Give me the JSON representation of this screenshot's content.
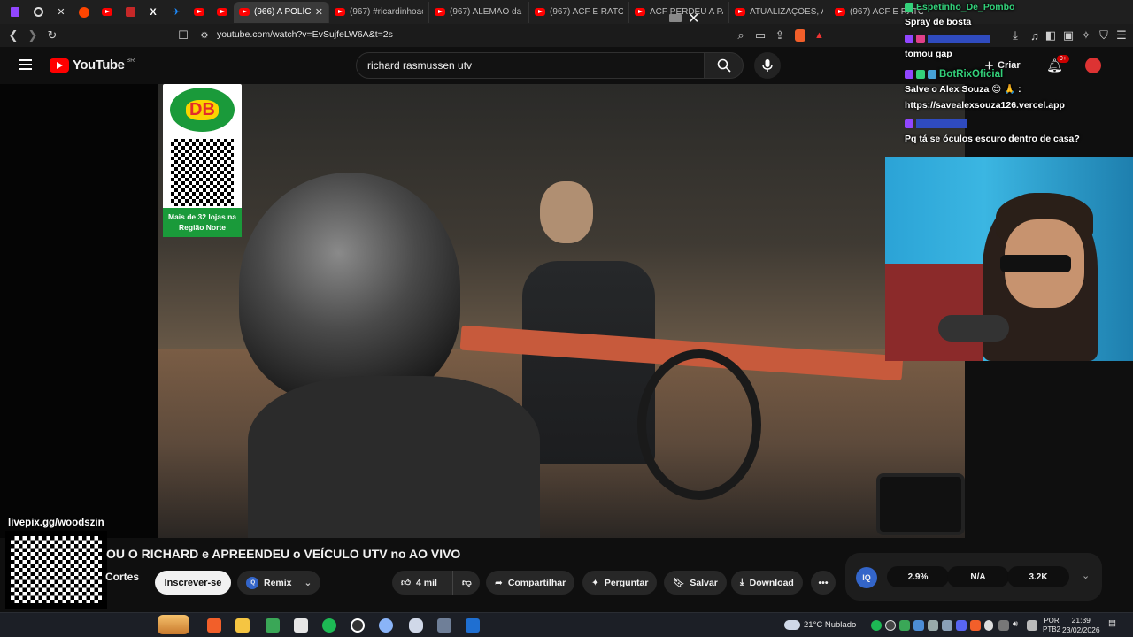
{
  "tabs": [
    {
      "label": "(966) A POLÍCIA P",
      "active": true
    },
    {
      "label": "(967) #ricardinhoacf #",
      "active": false
    },
    {
      "label": "(967) ALEMÃO da CAR",
      "active": false
    },
    {
      "label": "(967) ACF E RATO DIS",
      "active": false
    },
    {
      "label": "ACF PERDEU A PACIÊN",
      "active": false
    },
    {
      "label": "ATUALIZAÇÕES, ACF E",
      "active": false
    },
    {
      "label": "(967) ACF E RATO DIS",
      "active": false
    }
  ],
  "address": {
    "url": "youtube.com/watch?v=EvSujfeLW6A&t=2s"
  },
  "youtube": {
    "logo": "YouTube",
    "region": "BR",
    "search_query": "richard rasmussen utv",
    "create_label": "Criar",
    "notif_count": "9+"
  },
  "ad": {
    "brand": "DB",
    "text": "Mais de 32 lojas na Região Norte"
  },
  "chat": [
    {
      "user": "Espetinho_De_Pombo",
      "user_color": "#33d17a",
      "message": "Spray de bosta"
    },
    {
      "user": "",
      "user_color": "#5a7bff",
      "message": "tomou gap"
    },
    {
      "user": "BotRixOficial",
      "user_color": "#33d17a",
      "message": "Salve o Alex Souza 😊 🙏 :"
    },
    {
      "user": "",
      "user_color": "#ffffff",
      "message": "https://savealexsouza126.vercel.app"
    },
    {
      "user": "",
      "user_color": "#5a7bff",
      "message": "Pq tá se óculos escuro dentro de casa?"
    }
  ],
  "overlay": {
    "livepix": "livepix.gg/woodszin"
  },
  "video": {
    "title": "OU O RICHARD e APREENDEU o VEÍCULO UTV no AO VIVO",
    "channel": "Cortes",
    "subscribe_label": "Inscrever-se",
    "remix_label": "Remix",
    "likes": "4 mil",
    "share_label": "Compartilhar",
    "ask_label": "Perguntar",
    "save_label": "Salvar",
    "download_label": "Download"
  },
  "iq_stats": [
    "2.9%",
    "N/A",
    "3.2K"
  ],
  "taskbar": {
    "weather": "21°C  Nublado",
    "lang": "POR",
    "layout": "PTB2",
    "time": "21:39",
    "date": "23/02/2026"
  },
  "colors": {
    "accent": "#ff0000",
    "ad_green": "#1a9a3a",
    "iq_blue": "#3365c9"
  }
}
